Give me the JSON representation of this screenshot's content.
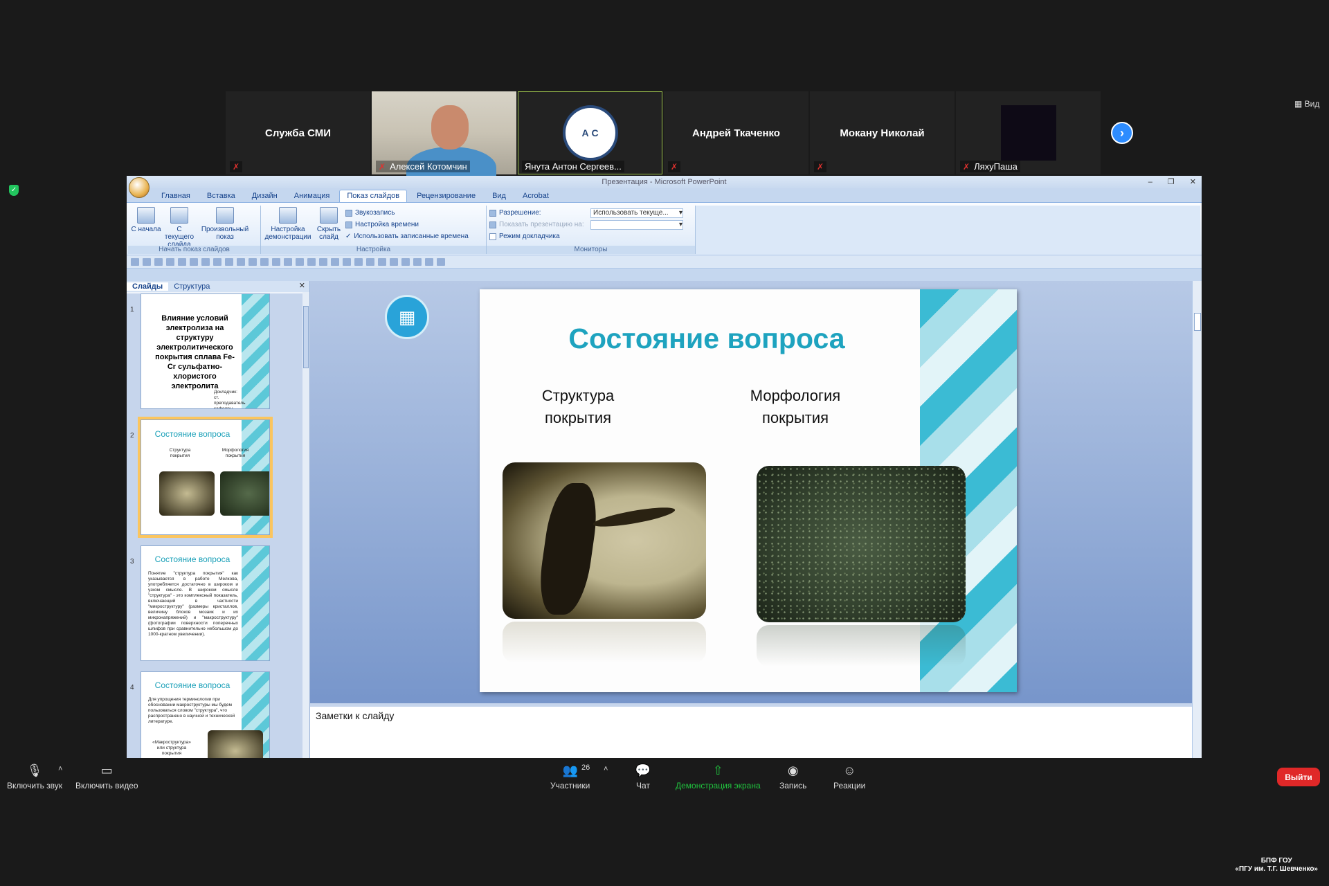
{
  "meeting": {
    "view_label": "Вид",
    "participants": [
      {
        "name": "Служба СМИ",
        "label": "",
        "muted": true,
        "kind": "name"
      },
      {
        "name": "",
        "label": "Алексей Котомчин",
        "muted": true,
        "kind": "video"
      },
      {
        "name": "",
        "label": "Янута Антон Сергеев...",
        "muted": false,
        "kind": "logo"
      },
      {
        "name": "Андрей Ткаченко",
        "label": "",
        "muted": true,
        "kind": "name"
      },
      {
        "name": "Мокану Николай",
        "label": "",
        "muted": true,
        "kind": "name"
      },
      {
        "name": "",
        "label": "ЛяхуПаша",
        "muted": true,
        "kind": "dark"
      }
    ],
    "logo_text": "А С"
  },
  "ppt": {
    "title": "Презентация - Microsoft PowerPoint",
    "tabs": [
      "Главная",
      "Вставка",
      "Дизайн",
      "Анимация",
      "Показ слайдов",
      "Рецензирование",
      "Вид",
      "Acrobat"
    ],
    "active_tab": "Показ слайдов",
    "ribbon": {
      "start_group": "Начать показ слайдов",
      "from_start": "С начала",
      "from_current": "С текущего слайда",
      "custom_show": "Произвольный показ",
      "setup_group": "Настройка",
      "setup_show": "Настройка демонстрации",
      "hide_slide": "Скрыть слайд",
      "record_narration": "Звукозапись",
      "rehearse": "Настройка времени",
      "use_timings": "Использовать записанные времена",
      "monitors_group": "Мониторы",
      "resolution_label": "Разрешение:",
      "resolution_value": "Использовать текуще...",
      "show_on_label": "Показать презентацию на:",
      "presenter_view": "Режим докладчика"
    },
    "panel_tabs": [
      "Слайды",
      "Структура"
    ],
    "thumbs": [
      {
        "num": "1",
        "title": "Влияние условий электролиза на структуру электролитического покрытия сплава Fe-Cr сульфатно-хлористого электролита",
        "small": "Докладчик: ст. преподаватель кафедры МАДИ Янута А. С."
      },
      {
        "num": "2",
        "title": "Состояние вопроса",
        "col1": "Структура покрытия",
        "col2": "Морфология покрытия"
      },
      {
        "num": "3",
        "title": "Состояние вопроса",
        "body": "Понятие \"структура покрытия\" как указывается в работе Мелкова, употребляется достаточно в широком и узком смысле. В широком смысле \"структура\" - это комплексный показатель, включающий в частности \"микроструктуру\" (размеры кристаллов, величину блоков мозаик и их микронапряжений) и \"макроструктуру\" (фотографии поверхности поперечных шлифов при сравнительно небольшом до 1000-кратном увеличении)."
      },
      {
        "num": "4",
        "title": "Состояние вопроса",
        "body": "Для упрощения терминологии при обосновании макроструктуры мы будем пользоваться словом \"структура\", что распространено в научной и технической литературе.",
        "body2": "«Макроструктура» или структура покрытия"
      }
    ],
    "slide": {
      "title": "Состояние вопроса",
      "col1": "Структура\nпокрытия",
      "col2": "Морфология\nпокрытия"
    },
    "notes_placeholder": "Заметки к слайду"
  },
  "toolbar": {
    "mute": "Включить звук",
    "video": "Включить видео",
    "participants": "Участники",
    "participants_count": "26",
    "chat": "Чат",
    "share": "Демонстрация экрана",
    "record": "Запись",
    "reactions": "Реакции",
    "leave": "Выйти"
  },
  "watermark": {
    "line1": "БПФ ГОУ",
    "line2": "«ПГУ им. Т.Г. Шевченко»"
  },
  "colors": {
    "accent_teal": "#1ea3bf",
    "zoom_blue": "#2d8cff",
    "leave_red": "#e02828",
    "share_green": "#20c33e"
  }
}
